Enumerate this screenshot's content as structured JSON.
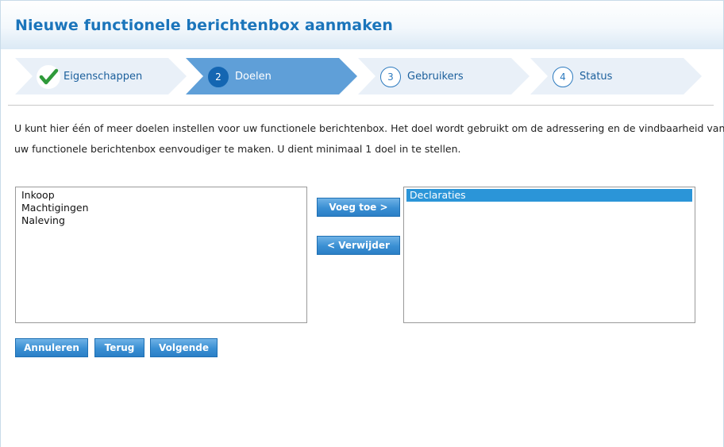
{
  "page": {
    "title": "Nieuwe functionele berichtenbox aanmaken"
  },
  "steps": [
    {
      "number": "",
      "label": "Eigenschappen",
      "state": "completed",
      "icon": "check-icon"
    },
    {
      "number": "2",
      "label": "Doelen",
      "state": "active"
    },
    {
      "number": "3",
      "label": "Gebruikers",
      "state": "pending"
    },
    {
      "number": "4",
      "label": "Status",
      "state": "pending"
    }
  ],
  "intro": {
    "line1": "U kunt hier één of meer doelen instellen voor uw functionele berichtenbox. Het doel wordt gebruikt om de adressering en de vindbaarheid van",
    "line2": "uw functionele berichtenbox eenvoudiger te maken. U dient minimaal 1 doel in te stellen."
  },
  "available": {
    "items": [
      "Inkoop",
      "Machtigingen",
      "Naleving"
    ]
  },
  "selected": {
    "items": [
      "Declaraties"
    ],
    "highlighted": "Declaraties"
  },
  "transfer": {
    "add_label": "Voeg toe >",
    "remove_label": "< Verwijder"
  },
  "footer": {
    "cancel_label": "Annuleren",
    "back_label": "Terug",
    "next_label": "Volgende"
  },
  "colors": {
    "accent": "#1b75bb",
    "step_active": "#5f9fd8",
    "step_inactive": "#e9f0f8",
    "check": "#2f9a3a",
    "selection": "#2b95d8"
  }
}
